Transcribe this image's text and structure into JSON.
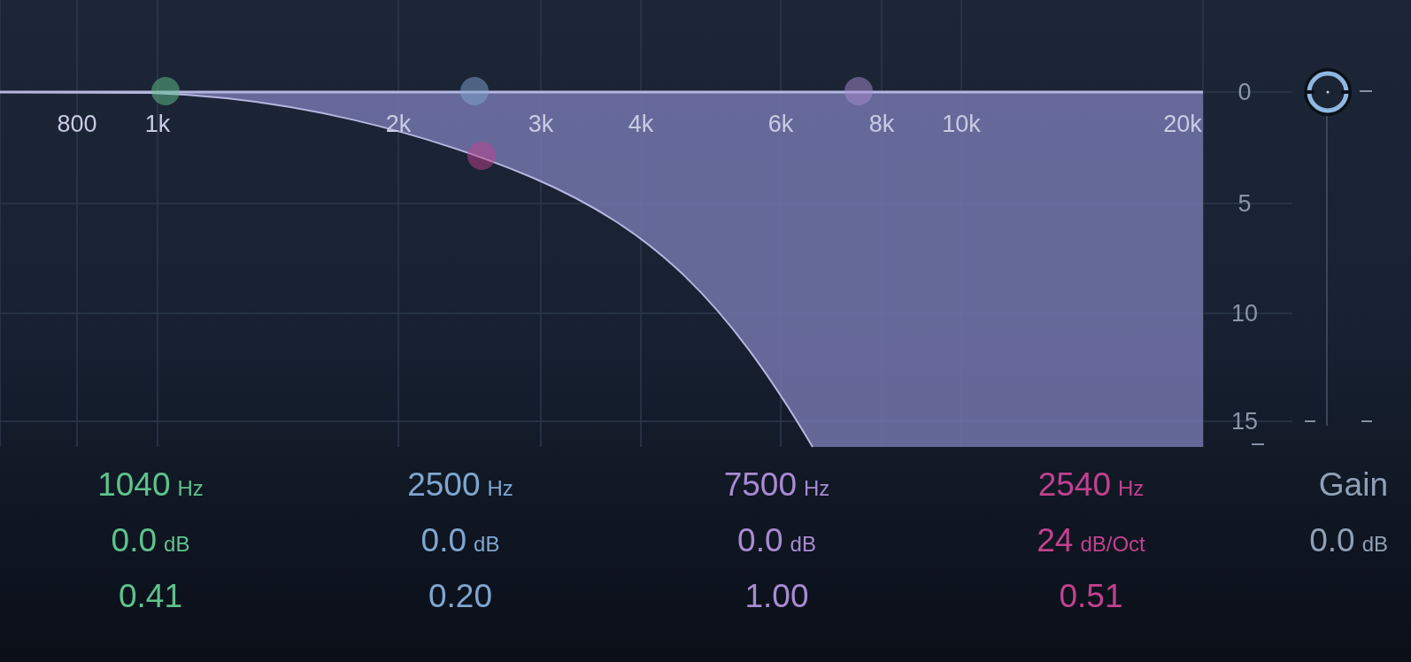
{
  "graph": {
    "frequency_labels": [
      "800",
      "1k",
      "2k",
      "3k",
      "4k",
      "6k",
      "8k",
      "10k",
      "20k"
    ],
    "db_labels": [
      "0",
      "5",
      "10",
      "15"
    ]
  },
  "bands": [
    {
      "color": "#5fc28c",
      "frequency": "1040",
      "frequency_unit": "Hz",
      "gain": "0.0",
      "gain_unit": "dB",
      "q": "0.41"
    },
    {
      "color": "#7fa6d0",
      "frequency": "2500",
      "frequency_unit": "Hz",
      "gain": "0.0",
      "gain_unit": "dB",
      "q": "0.20"
    },
    {
      "color": "#a88bd2",
      "frequency": "7500",
      "frequency_unit": "Hz",
      "gain": "0.0",
      "gain_unit": "dB",
      "q": "1.00"
    },
    {
      "color": "#c2418f",
      "frequency": "2540",
      "frequency_unit": "Hz",
      "gain": "24",
      "gain_unit": "dB/Oct",
      "q": "0.51"
    }
  ],
  "output_gain": {
    "label": "Gain",
    "value": "0.0",
    "unit": "dB"
  }
}
